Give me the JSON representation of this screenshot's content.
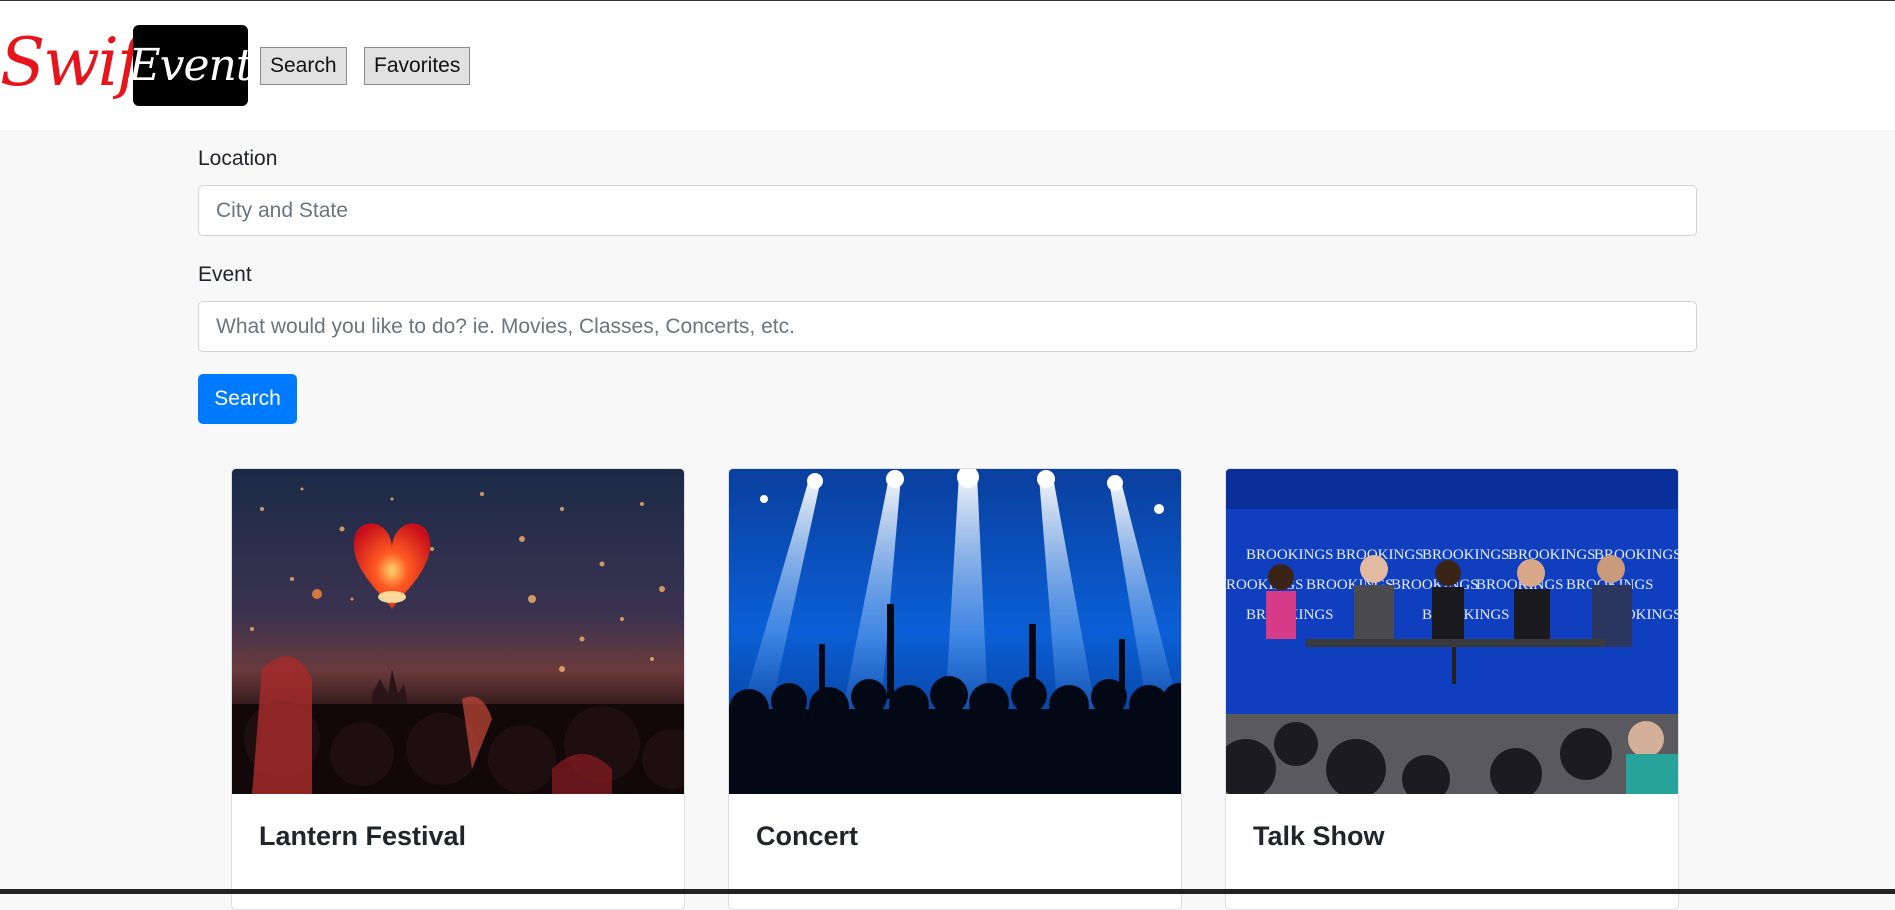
{
  "nav": {
    "brand_part1": "Swift",
    "brand_part2": "Event",
    "search_label": "Search",
    "favorites_label": "Favorites"
  },
  "form": {
    "location_label": "Location",
    "location_placeholder": "City and State",
    "location_value": "",
    "event_label": "Event",
    "event_placeholder": "What would you like to do? ie. Movies, Classes, Concerts, etc.",
    "event_value": "",
    "submit_label": "Search"
  },
  "cards": [
    {
      "title": "Lantern Festival",
      "image": "lantern-festival-photo"
    },
    {
      "title": "Concert",
      "image": "concert-crowd-photo"
    },
    {
      "title": "Talk Show",
      "image": "panel-discussion-photo"
    }
  ],
  "talk_show_backdrop_text": "BROOKINGS",
  "colors": {
    "brand_red": "#e8141b",
    "primary_blue": "#007bff",
    "page_bg": "#f8f8f8"
  }
}
